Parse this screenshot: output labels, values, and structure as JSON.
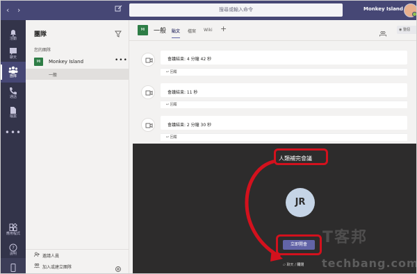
{
  "topbar": {
    "back_arrow": "‹",
    "forward_arrow": "›",
    "search_placeholder": "搜尋或輸入命令",
    "org_name": "Monkey Island",
    "org_chevron": "⌄"
  },
  "rail": {
    "items": [
      {
        "label": "活動",
        "icon": "bell-icon"
      },
      {
        "label": "聊天",
        "icon": "chat-icon"
      },
      {
        "label": "團隊",
        "icon": "teams-icon"
      },
      {
        "label": "通話",
        "icon": "phone-icon"
      },
      {
        "label": "檔案",
        "icon": "files-icon"
      }
    ],
    "more": "•••",
    "apps_label": "應用程式",
    "help_label": "說明"
  },
  "panel": {
    "title": "團隊",
    "section": "您的團隊",
    "team_badge": "MI",
    "team_name": "Monkey Island",
    "team_more": "•••",
    "channel": "一般",
    "invite_label": "邀請人員",
    "join_label": "加入或建立團隊"
  },
  "channel_header": {
    "badge": "MI",
    "name": "一般",
    "tabs": [
      "貼文",
      "檔案",
      "Wiki"
    ],
    "add_tab": "+",
    "right_button": "整個"
  },
  "feed": {
    "messages": [
      {
        "text": "會議結束: 4 分鐘 42 秒",
        "reply": "↩ 回覆"
      },
      {
        "text": "會議結束: 11 秒",
        "reply": "↩ 回覆"
      },
      {
        "text": "會議結束: 2 分鐘 30 秒",
        "reply": "↩ 回覆"
      }
    ]
  },
  "meeting": {
    "title": "人類補完會議",
    "avatar_initials": "JR",
    "join_button": "立即開會",
    "bottom_left": "聊天",
    "bottom_sep": "/",
    "bottom_right": "關閉"
  },
  "watermark": {
    "line1": "T客邦",
    "line2": "techbang.com"
  },
  "colors": {
    "topbar": "#464775",
    "rail": "#33344a",
    "accent": "#6264a7",
    "team_green": "#2e7d46",
    "highlight_red": "#d3111d"
  }
}
